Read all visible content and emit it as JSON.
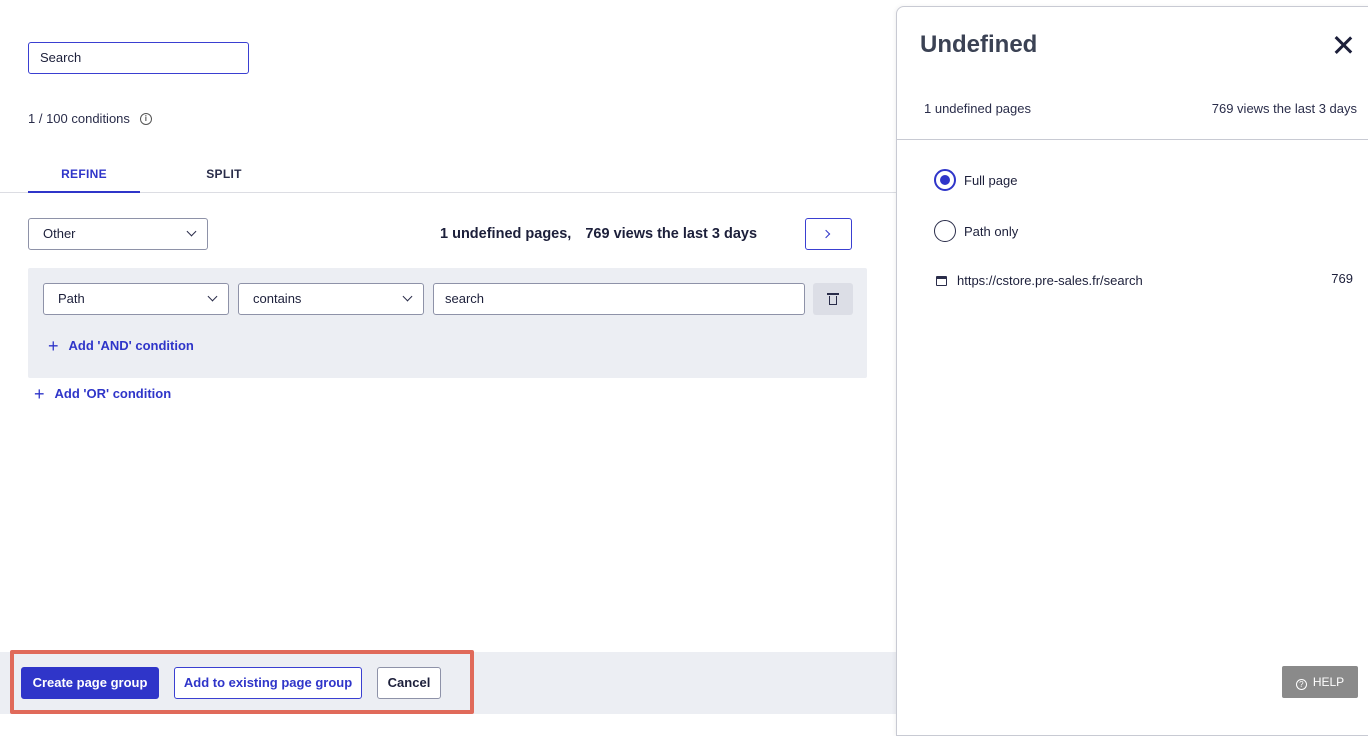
{
  "search": {
    "value": "Search"
  },
  "conditions": {
    "count_label": "1 / 100 conditions",
    "info_icon": "info-icon"
  },
  "tabs": [
    {
      "label": "REFINE",
      "active": true
    },
    {
      "label": "SPLIT",
      "active": false
    }
  ],
  "filter": {
    "category_select": "Other",
    "undefined_pages": "1 undefined pages,",
    "views": "769 views the last 3 days"
  },
  "condition_row": {
    "field": "Path",
    "operator": "contains",
    "value": "search",
    "add_and_label": "Add 'AND' condition"
  },
  "add_or_label": "Add 'OR' condition",
  "footer": {
    "create_label": "Create page group",
    "add_existing_label": "Add to existing page group",
    "cancel_label": "Cancel"
  },
  "side_panel": {
    "title": "Undefined",
    "undefined_pages": "1 undefined pages",
    "views": "769 views the last 3 days",
    "radio_full": "Full page",
    "radio_path": "Path only",
    "url": "https://cstore.pre-sales.fr/search",
    "url_count": "769",
    "help_label": "HELP"
  },
  "colors": {
    "accent": "#2f35c9",
    "highlight": "#e06a5a",
    "panel_bg": "#eceef3"
  }
}
